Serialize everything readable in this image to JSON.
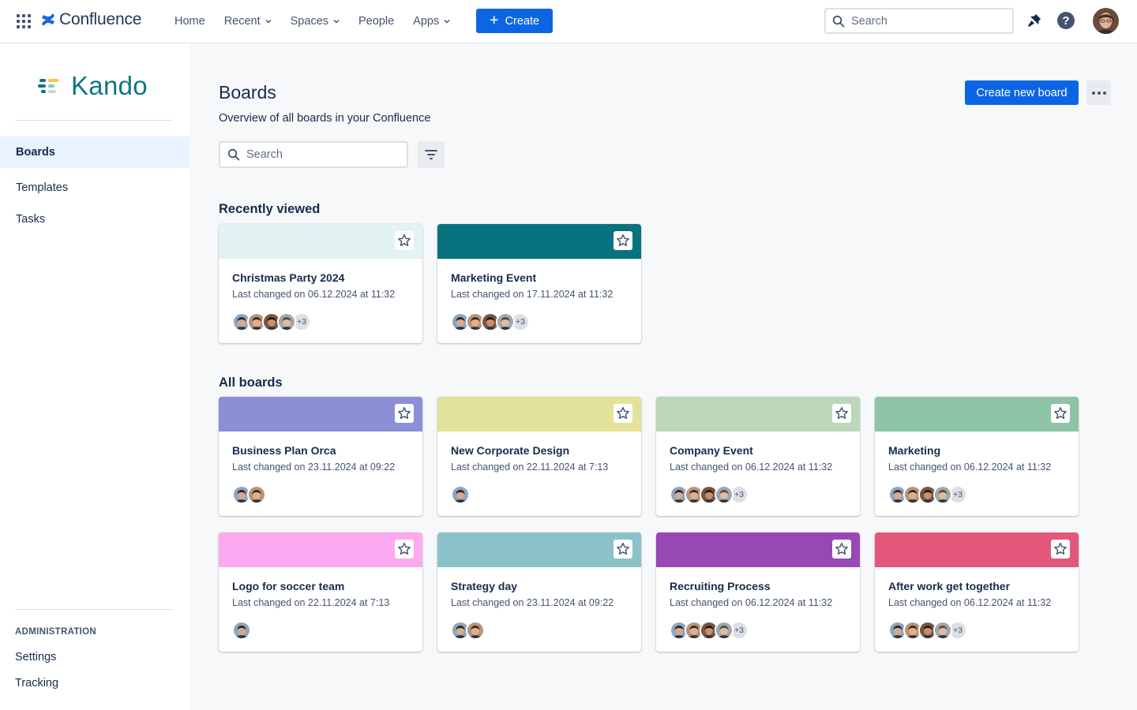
{
  "topnav": {
    "brand": "Confluence",
    "items": [
      {
        "label": "Home",
        "dropdown": false
      },
      {
        "label": "Recent",
        "dropdown": true
      },
      {
        "label": "Spaces",
        "dropdown": true
      },
      {
        "label": "People",
        "dropdown": false
      },
      {
        "label": "Apps",
        "dropdown": true
      }
    ],
    "create_label": "Create",
    "search_placeholder": "Search"
  },
  "sidebar": {
    "logo_text": "Kando",
    "items": [
      {
        "label": "Boards",
        "active": true
      },
      {
        "label": "Templates",
        "active": false
      },
      {
        "label": "Tasks",
        "active": false
      }
    ],
    "admin_title": "ADMINISTRATION",
    "admin_items": [
      "Settings",
      "Tracking"
    ]
  },
  "main": {
    "title": "Boards",
    "subtitle": "Overview of all boards in your Confluence",
    "create_board_label": "Create new board",
    "search_placeholder": "Search",
    "recent_title": "Recently viewed",
    "all_title": "All boards"
  },
  "recent_boards": [
    {
      "title": "Christmas Party 2024",
      "date": "Last changed on 06.12.2024 at 11:32",
      "color": "#e3f2f2",
      "avatars": 4,
      "more": "+3"
    },
    {
      "title": "Marketing Event",
      "date": "Last changed on 17.11.2024 at 11:32",
      "color": "#08737f",
      "avatars": 4,
      "more": "+3"
    }
  ],
  "all_boards": [
    {
      "title": "Business Plan Orca",
      "date": "Last changed on 23.11.2024 at 09:22",
      "color": "#8b8fd6",
      "avatars": 2,
      "more": ""
    },
    {
      "title": "New Corporate Design",
      "date": "Last changed on 22.11.2024 at 7:13",
      "color": "#e3e29a",
      "avatars": 1,
      "more": ""
    },
    {
      "title": "Company Event",
      "date": "Last changed on 06.12.2024 at 11:32",
      "color": "#bcd6bb",
      "avatars": 4,
      "more": "+3"
    },
    {
      "title": "Marketing",
      "date": "Last changed on 06.12.2024 at 11:32",
      "color": "#8cc4a5",
      "avatars": 4,
      "more": "+3"
    },
    {
      "title": "Logo for soccer team",
      "date": "Last changed on 22.11.2024 at 7:13",
      "color": "#fba9f1",
      "avatars": 1,
      "more": ""
    },
    {
      "title": "Strategy day",
      "date": "Last changed on 23.11.2024 at 09:22",
      "color": "#8bc1c9",
      "avatars": 2,
      "more": ""
    },
    {
      "title": "Recruiting Process",
      "date": "Last changed on 06.12.2024 at 11:32",
      "color": "#9848b4",
      "avatars": 4,
      "more": "+3"
    },
    {
      "title": "After work get together",
      "date": "Last changed on 06.12.2024 at 11:32",
      "color": "#e3577a",
      "avatars": 4,
      "more": "+3"
    }
  ]
}
